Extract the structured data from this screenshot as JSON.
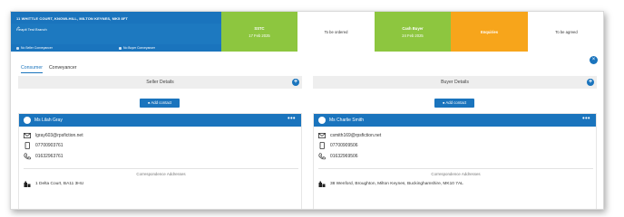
{
  "property": {
    "address": "11 WHITTLE COURT, KNOWLHILL, MILTON KEYNES, MK5 8FT",
    "branch": "Reapit Test Branch",
    "seller_conveyancer": "No Seller Conveyancer",
    "buyer_conveyancer": "No Buyer Conveyancer"
  },
  "stages": [
    {
      "title": "SSTC",
      "date": "17 Feb 2025",
      "color": "#8dc63f"
    },
    {
      "title": "To be ordered",
      "date": "",
      "color": "#ffffff"
    },
    {
      "title": "Cash Buyer",
      "date": "24 Feb 2025",
      "color": "#8dc63f"
    },
    {
      "title": "Enquiries",
      "date": "",
      "color": "#f7a51b"
    },
    {
      "title": "To be agreed",
      "date": "",
      "color": "#ffffff"
    }
  ],
  "tabs": [
    "Consumer",
    "Conveyancer"
  ],
  "seller": {
    "heading": "Seller Details",
    "add_label": "Add contact",
    "name": "Ms Lilah Gray",
    "email": "lgray603@rpsfiction.net",
    "mobile": "07700903761",
    "phone": "01632963761",
    "corr_heading": "Correspondence Addresses",
    "address": "1 Delta Court, BA11 3HU"
  },
  "buyer": {
    "heading": "Buyer Details",
    "add_label": "Add contact",
    "name": "Ms Charlie Smith",
    "email": "csmith169@rpsfiction.net",
    "mobile": "07700909506",
    "phone": "01632969506",
    "corr_heading": "Correspondence Addresses",
    "address": "38 Wenford, Broughton, Milton Keynes, Buckinghamshire, MK10 7AL"
  },
  "colors": {
    "accent": "#1a74bd",
    "green": "#8dc63f",
    "orange": "#f7a51b"
  }
}
